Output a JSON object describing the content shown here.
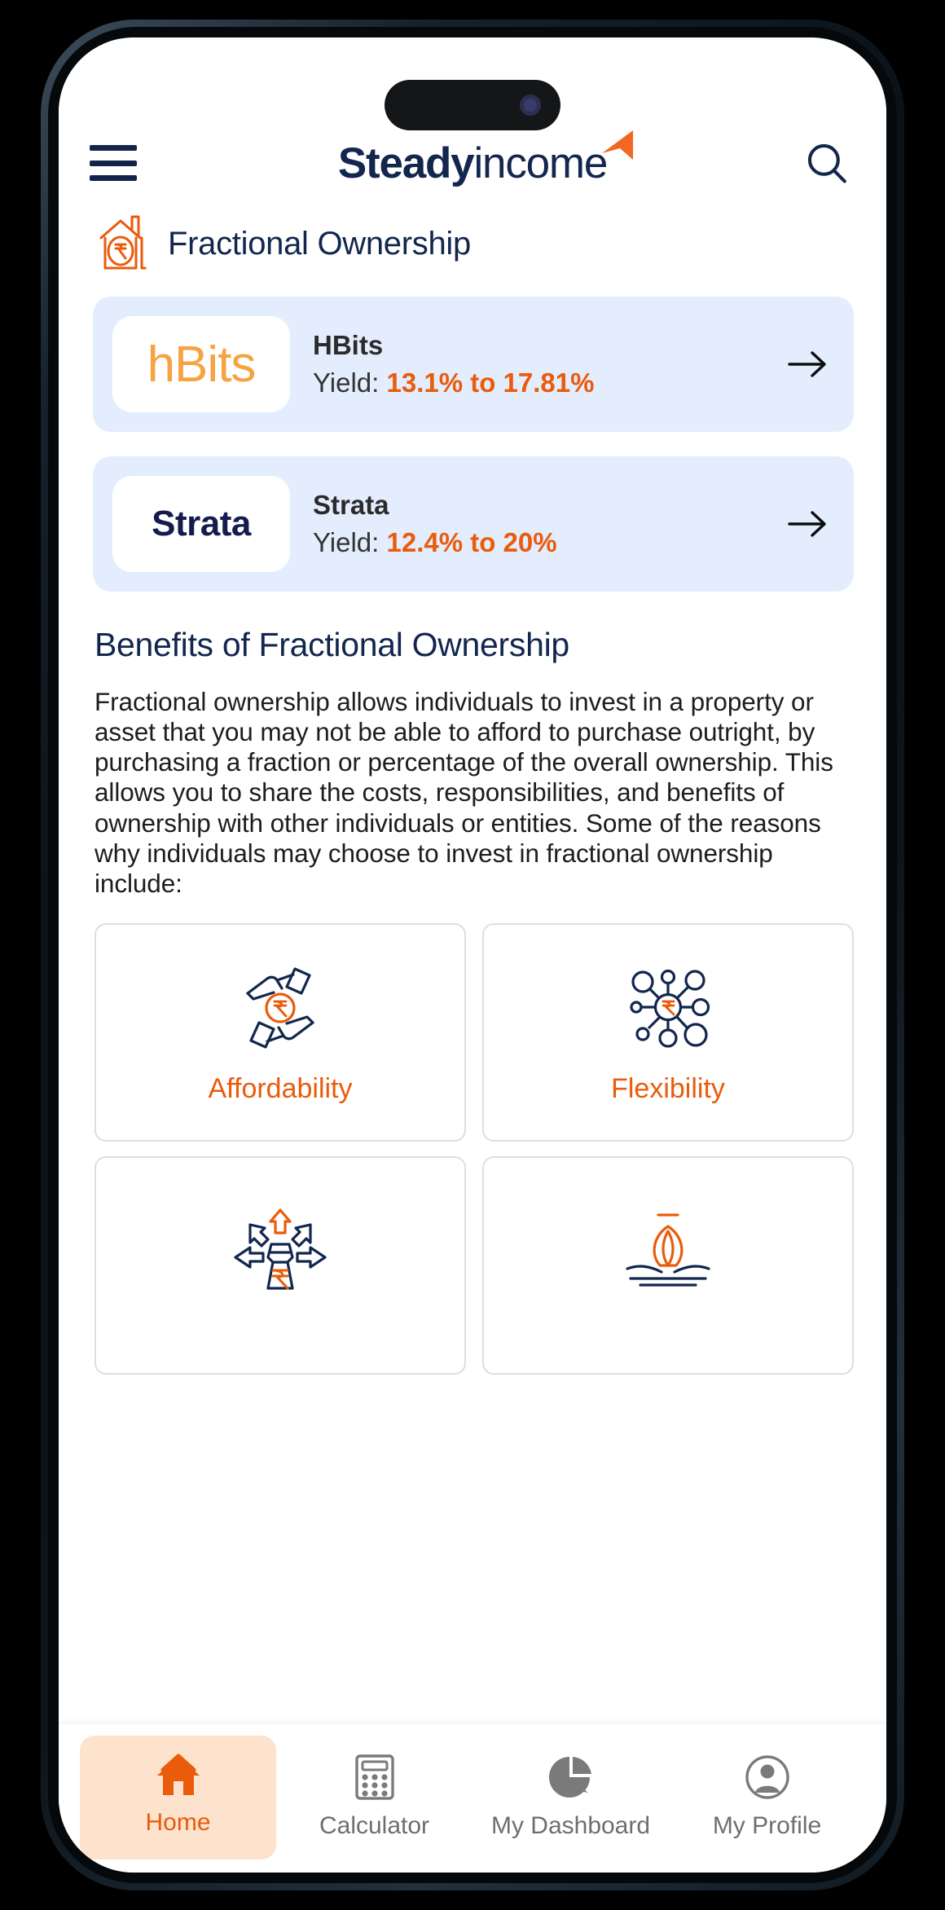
{
  "header": {
    "menu_label": "menu",
    "brand_strong": "Steady",
    "brand_light": "income",
    "search_label": "search"
  },
  "section": {
    "title": "Fractional Ownership"
  },
  "providers": [
    {
      "logo_text": "hBits",
      "name": "HBits",
      "yield_prefix": "Yield: ",
      "yield_value": "13.1% to 17.81%",
      "arrow": "→"
    },
    {
      "logo_text": "Strata",
      "name": "Strata",
      "yield_prefix": "Yield: ",
      "yield_value": "12.4% to 20%",
      "arrow": "→"
    }
  ],
  "benefits": {
    "heading": "Benefits of Fractional Ownership",
    "paragraph": "Fractional ownership allows individuals to invest in a property or asset that you may not be able to afford to purchase outright, by purchasing a fraction or percentage of the overall ownership. This allows you to share the costs, responsibilities, and benefits of ownership with other individuals or entities. Some of the reasons why individuals may choose to invest in fractional ownership include:",
    "cards": [
      {
        "label": "Affordability",
        "icon": "hands-rupee-icon"
      },
      {
        "label": "Flexibility",
        "icon": "network-rupee-icon"
      },
      {
        "label": "",
        "icon": "diversification-arrows-icon"
      },
      {
        "label": "",
        "icon": "growth-rupee-icon"
      }
    ]
  },
  "bottom_nav": {
    "items": [
      {
        "label": "Home",
        "icon": "home-icon",
        "active": true
      },
      {
        "label": "Calculator",
        "icon": "calculator-icon",
        "active": false
      },
      {
        "label": "My Dashboard",
        "icon": "pie-chart-icon",
        "active": false
      },
      {
        "label": "My Profile",
        "icon": "user-circle-icon",
        "active": false
      }
    ]
  },
  "colors": {
    "brand_navy": "#12264e",
    "accent_orange": "#ea5b0c",
    "card_blue": "#e4edfd",
    "active_pill": "#fde3cd",
    "hbits_orange": "#f6a341"
  }
}
